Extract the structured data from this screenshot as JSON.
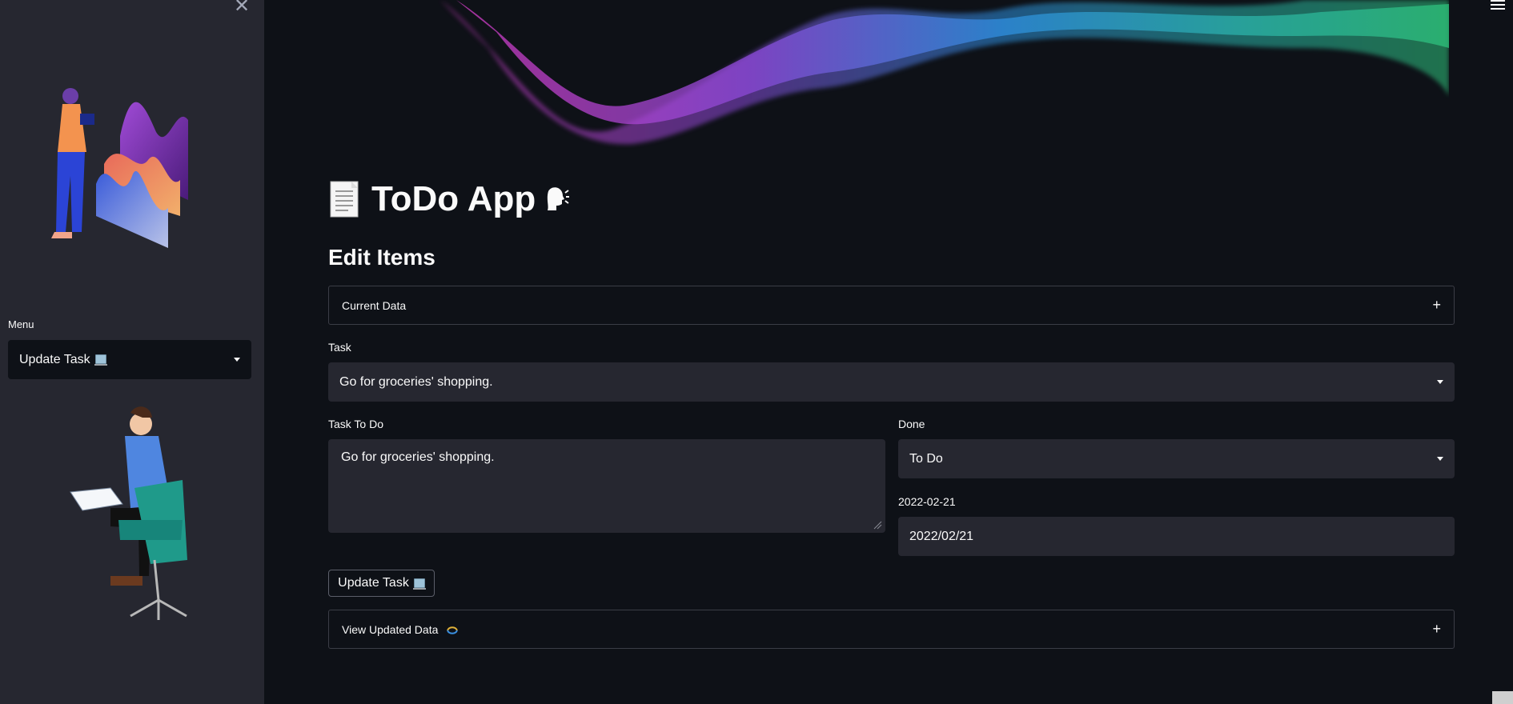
{
  "sidebar": {
    "close_icon": "✕",
    "menu_label": "Menu",
    "menu_value": "Update Task"
  },
  "main": {
    "app_title": "ToDo App",
    "section_title": "Edit Items",
    "current_data_label": "Current Data",
    "task_label": "Task",
    "task_value": "Go for groceries' shopping.",
    "task_todo_label": "Task To Do",
    "task_todo_value": "Go for groceries' shopping.",
    "done_label": "Done",
    "done_value": "To Do",
    "date_label": "2022-02-21",
    "date_value": "2022/02/21",
    "update_button": "Update Task",
    "view_updated_label": "View Updated Data",
    "expander_icon": "+"
  },
  "colors": {
    "background": "#0e1117",
    "sidebar": "#262730",
    "input": "#262730"
  }
}
